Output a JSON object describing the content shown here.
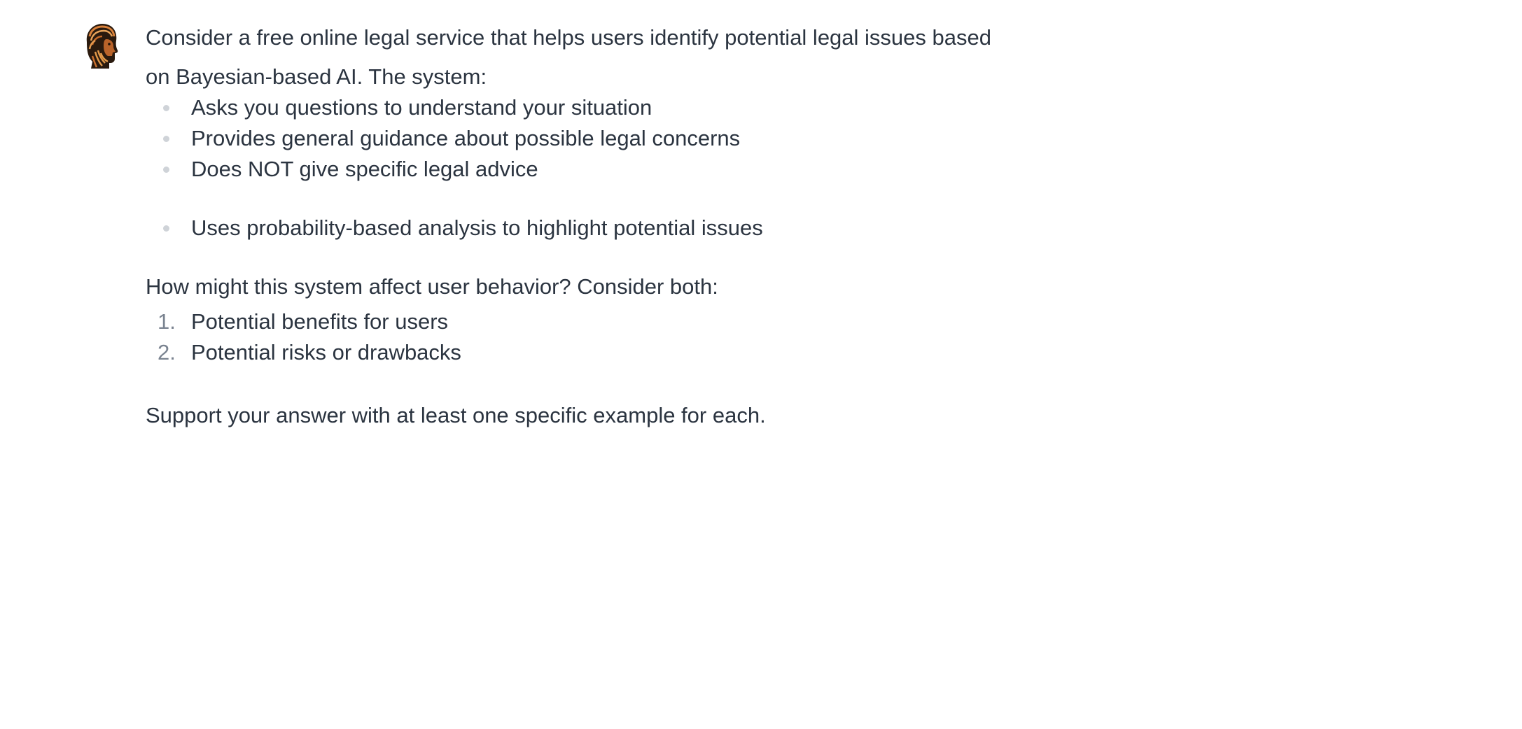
{
  "message": {
    "avatar_icon": "bearded-scholar-head-avatar",
    "intro_line1": "Consider a free online legal service that helps users identify potential legal issues based",
    "intro_line2": "on Bayesian-based AI. The system:",
    "features": [
      "Asks you questions to understand your situation",
      "Provides general guidance about possible legal concerns",
      "Does NOT give specific legal advice",
      "Uses probability-based analysis to highlight potential issues"
    ],
    "question": "How might this system affect user behavior? Consider both:",
    "considerations": [
      {
        "number": "1.",
        "text": "Potential benefits for users"
      },
      {
        "number": "2.",
        "text": "Potential risks or drawbacks"
      }
    ],
    "closing": "Support your answer with at least one specific example for each."
  }
}
